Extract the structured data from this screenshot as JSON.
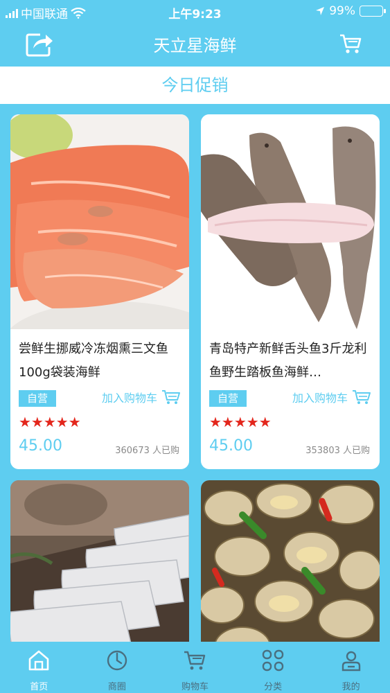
{
  "status_bar": {
    "carrier": "中国联通",
    "time": "上午9:23",
    "battery": "99%",
    "battery_level": 0.99
  },
  "navbar": {
    "title": "天立星海鲜",
    "share_icon": "share-icon",
    "cart_icon": "cart-icon"
  },
  "section": {
    "title": "今日促销"
  },
  "products": [
    {
      "name": "尝鲜生挪威冷冻烟熏三文鱼100g袋装海鲜",
      "badge": "自营",
      "add_cart": "加入购物车",
      "stars": "★★★★★",
      "rating": 5,
      "price": "45.00",
      "sold": "360673 人已购"
    },
    {
      "name": "青岛特产新鲜舌头鱼3斤龙利鱼野生踏板鱼海鲜…",
      "badge": "自营",
      "add_cart": "加入购物车",
      "stars": "★★★★★",
      "rating": 5,
      "price": "45.00",
      "sold": "353803 人已购"
    },
    {
      "name": "",
      "badge": "",
      "add_cart": "",
      "stars": "",
      "price": "",
      "sold": ""
    },
    {
      "name": "",
      "badge": "",
      "add_cart": "",
      "stars": "",
      "price": "",
      "sold": ""
    }
  ],
  "tabbar": [
    {
      "label": "首页",
      "icon": "home-icon",
      "active": true
    },
    {
      "label": "商圈",
      "icon": "compass-icon",
      "active": false
    },
    {
      "label": "购物车",
      "icon": "cart-icon",
      "active": false
    },
    {
      "label": "分类",
      "icon": "grid-icon",
      "active": false
    },
    {
      "label": "我的",
      "icon": "user-icon",
      "active": false
    }
  ],
  "colors": {
    "brand": "#5ecdf0",
    "star": "#e3261c",
    "card": "#ffffff"
  }
}
